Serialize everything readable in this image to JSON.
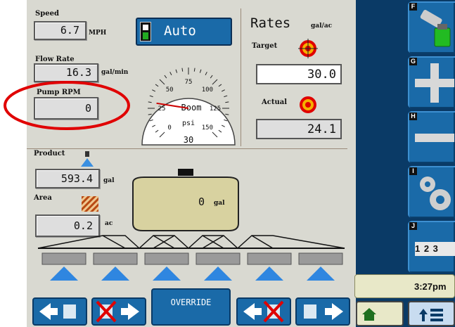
{
  "speed": {
    "label": "Speed",
    "value": "6.7",
    "unit": "MPH"
  },
  "mode": {
    "label": "Auto"
  },
  "flow_rate": {
    "label": "Flow Rate",
    "value": "16.3",
    "unit": "gal/min"
  },
  "pump": {
    "label": "Pump RPM",
    "value": "0"
  },
  "gauge": {
    "ticks": [
      "0",
      "25",
      "50",
      "75",
      "100",
      "125",
      "150"
    ],
    "label": "Boom",
    "unit": "psi",
    "value": "30",
    "reading": 30
  },
  "rates": {
    "title": "Rates",
    "unit": "gal/ac",
    "target_label": "Target",
    "target_value": "30.0",
    "actual_label": "Actual",
    "actual_value": "24.1"
  },
  "product": {
    "label": "Product",
    "value": "593.4",
    "unit": "gal"
  },
  "area": {
    "label": "Area",
    "value": "0.2",
    "unit": "ac"
  },
  "tank": {
    "value": "0",
    "unit": "gal"
  },
  "override": {
    "label": "OVERRIDE"
  },
  "sidebar": {
    "keys": [
      "F",
      "G",
      "H",
      "I",
      "J"
    ],
    "numpad_label": "1 2 3"
  },
  "clock": {
    "time": "3:27pm"
  },
  "colors": {
    "panel": "#d9d9d1",
    "button": "#1a6aa8",
    "dark": "#0a3a66",
    "accent_red": "#e00000",
    "green": "#22aa22"
  }
}
